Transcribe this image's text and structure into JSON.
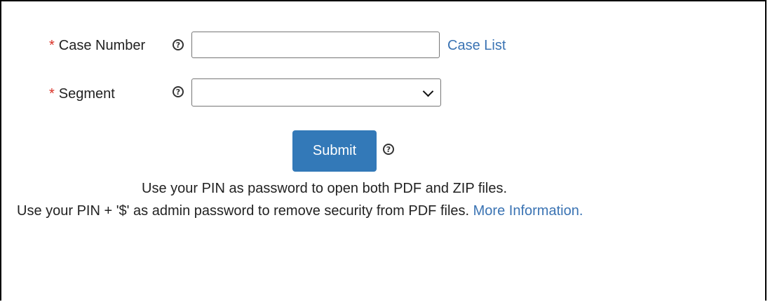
{
  "form": {
    "case_number": {
      "required_marker": "*",
      "label": "Case Number",
      "value": "",
      "placeholder": ""
    },
    "case_list_link": "Case List",
    "segment": {
      "required_marker": "*",
      "label": "Segment",
      "selected_value": ""
    },
    "submit_label": "Submit"
  },
  "notes": {
    "line1": "Use your PIN as password to open both PDF and ZIP files.",
    "line2": "Use your PIN + '$' as admin password to remove security from PDF files.",
    "more_info_link": "More Information."
  },
  "colors": {
    "required": "#d93025",
    "link": "#3a73b3",
    "button": "#3379b8"
  }
}
